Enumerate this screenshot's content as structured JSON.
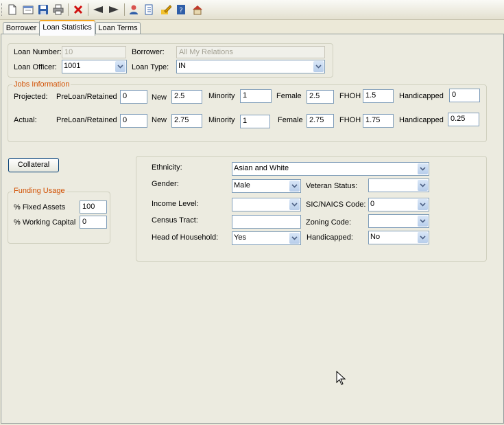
{
  "toolbar": {
    "icons": [
      "new-document-icon",
      "open-icon",
      "save-icon",
      "print-icon",
      "delete-icon",
      "previous-icon",
      "next-icon",
      "user-icon",
      "report-icon",
      "edit-icon",
      "help-icon",
      "home-icon"
    ]
  },
  "tabs": [
    "Borrower",
    "Loan Statistics",
    "Loan Terms"
  ],
  "loan": {
    "number_label": "Loan Number:",
    "number_value": "10",
    "borrower_label": "Borrower:",
    "borrower_value": "All My Relations",
    "officer_label": "Loan Officer:",
    "officer_value": "1001",
    "type_label": "Loan Type:",
    "type_value": "IN"
  },
  "jobs": {
    "legend": "Jobs Information",
    "projected_label": "Projected:",
    "actual_label": "Actual:",
    "preloan_label": "PreLoan/Retained",
    "new_label": "New",
    "minority_label": "Minority",
    "female_label": "Female",
    "fhoh_label": "FHOH",
    "handicapped_label": "Handicapped",
    "projected": {
      "preloan": "0",
      "new": "2.5",
      "minority": "1",
      "female": "2.5",
      "fhoh": "1.5",
      "handicapped": "0"
    },
    "actual": {
      "preloan": "0",
      "new": "2.75",
      "minority": "1",
      "female": "2.75",
      "fhoh": "1.75",
      "handicapped": "0.25"
    }
  },
  "collateral_button": "Collateral",
  "funding": {
    "legend": "Funding Usage",
    "fixed_label": "% Fixed Assets",
    "fixed_value": "100",
    "working_label": "% Working Capital",
    "working_value": "0"
  },
  "demographics": {
    "ethnicity_label": "Ethnicity:",
    "ethnicity_value": "Asian and White",
    "gender_label": "Gender:",
    "gender_value": "Male",
    "veteran_label": "Veteran Status:",
    "veteran_value": "",
    "income_label": "Income Level:",
    "income_value": "",
    "sic_label": "SIC/NAICS Code:",
    "sic_value": "0",
    "census_label": "Census Tract:",
    "census_value": "",
    "zoning_label": "Zoning Code:",
    "zoning_value": "",
    "head_label": "Head of Household:",
    "head_value": "Yes",
    "handicapped_label": "Handicapped:",
    "handicapped_value": "No"
  }
}
